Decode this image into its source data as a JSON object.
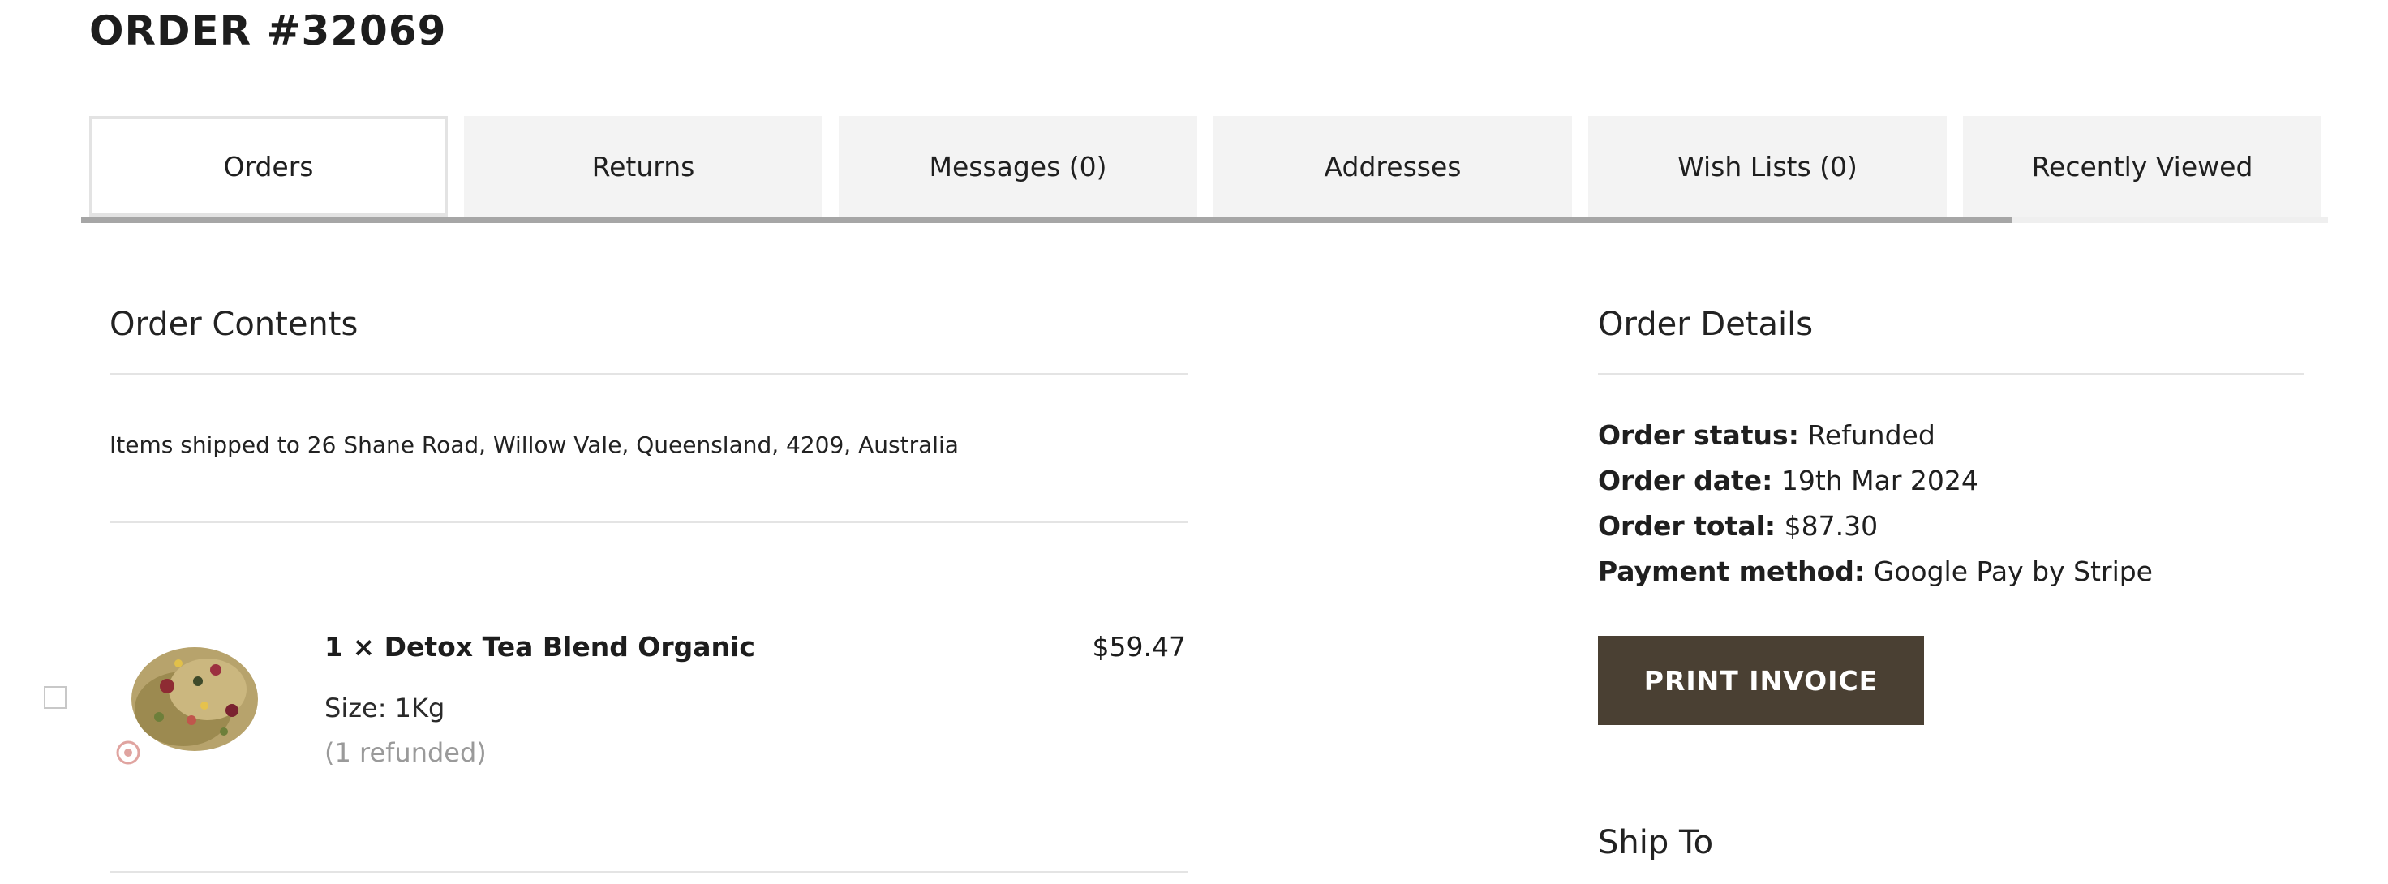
{
  "page": {
    "title": "ORDER #32069"
  },
  "tabs": [
    {
      "label": "Orders",
      "active": true
    },
    {
      "label": "Returns"
    },
    {
      "label": "Messages (0)"
    },
    {
      "label": "Addresses"
    },
    {
      "label": "Wish Lists (0)"
    },
    {
      "label": "Recently Viewed"
    }
  ],
  "order_contents": {
    "heading": "Order Contents",
    "shipping_note": "Items shipped to 26 Shane Road, Willow Vale, Queensland, 4209, Australia",
    "items": [
      {
        "title": "1 × Detox Tea Blend Organic",
        "price": "$59.47",
        "option_label": "Size:",
        "option_value": "1Kg",
        "status": "(1 refunded)"
      }
    ]
  },
  "order_details": {
    "heading": "Order Details",
    "rows": [
      {
        "label": "Order status:",
        "value": "Refunded"
      },
      {
        "label": "Order date:",
        "value": "19th Mar 2024"
      },
      {
        "label": "Order total:",
        "value": "$87.30"
      },
      {
        "label": "Payment method:",
        "value": "Google Pay by Stripe"
      }
    ],
    "print_label": "PRINT INVOICE"
  },
  "ship_to": {
    "heading": "Ship To"
  },
  "colors": {
    "primary_button": "#4a4033",
    "tab_bg": "#f3f3f3",
    "muted_text": "#9a9a9a"
  }
}
